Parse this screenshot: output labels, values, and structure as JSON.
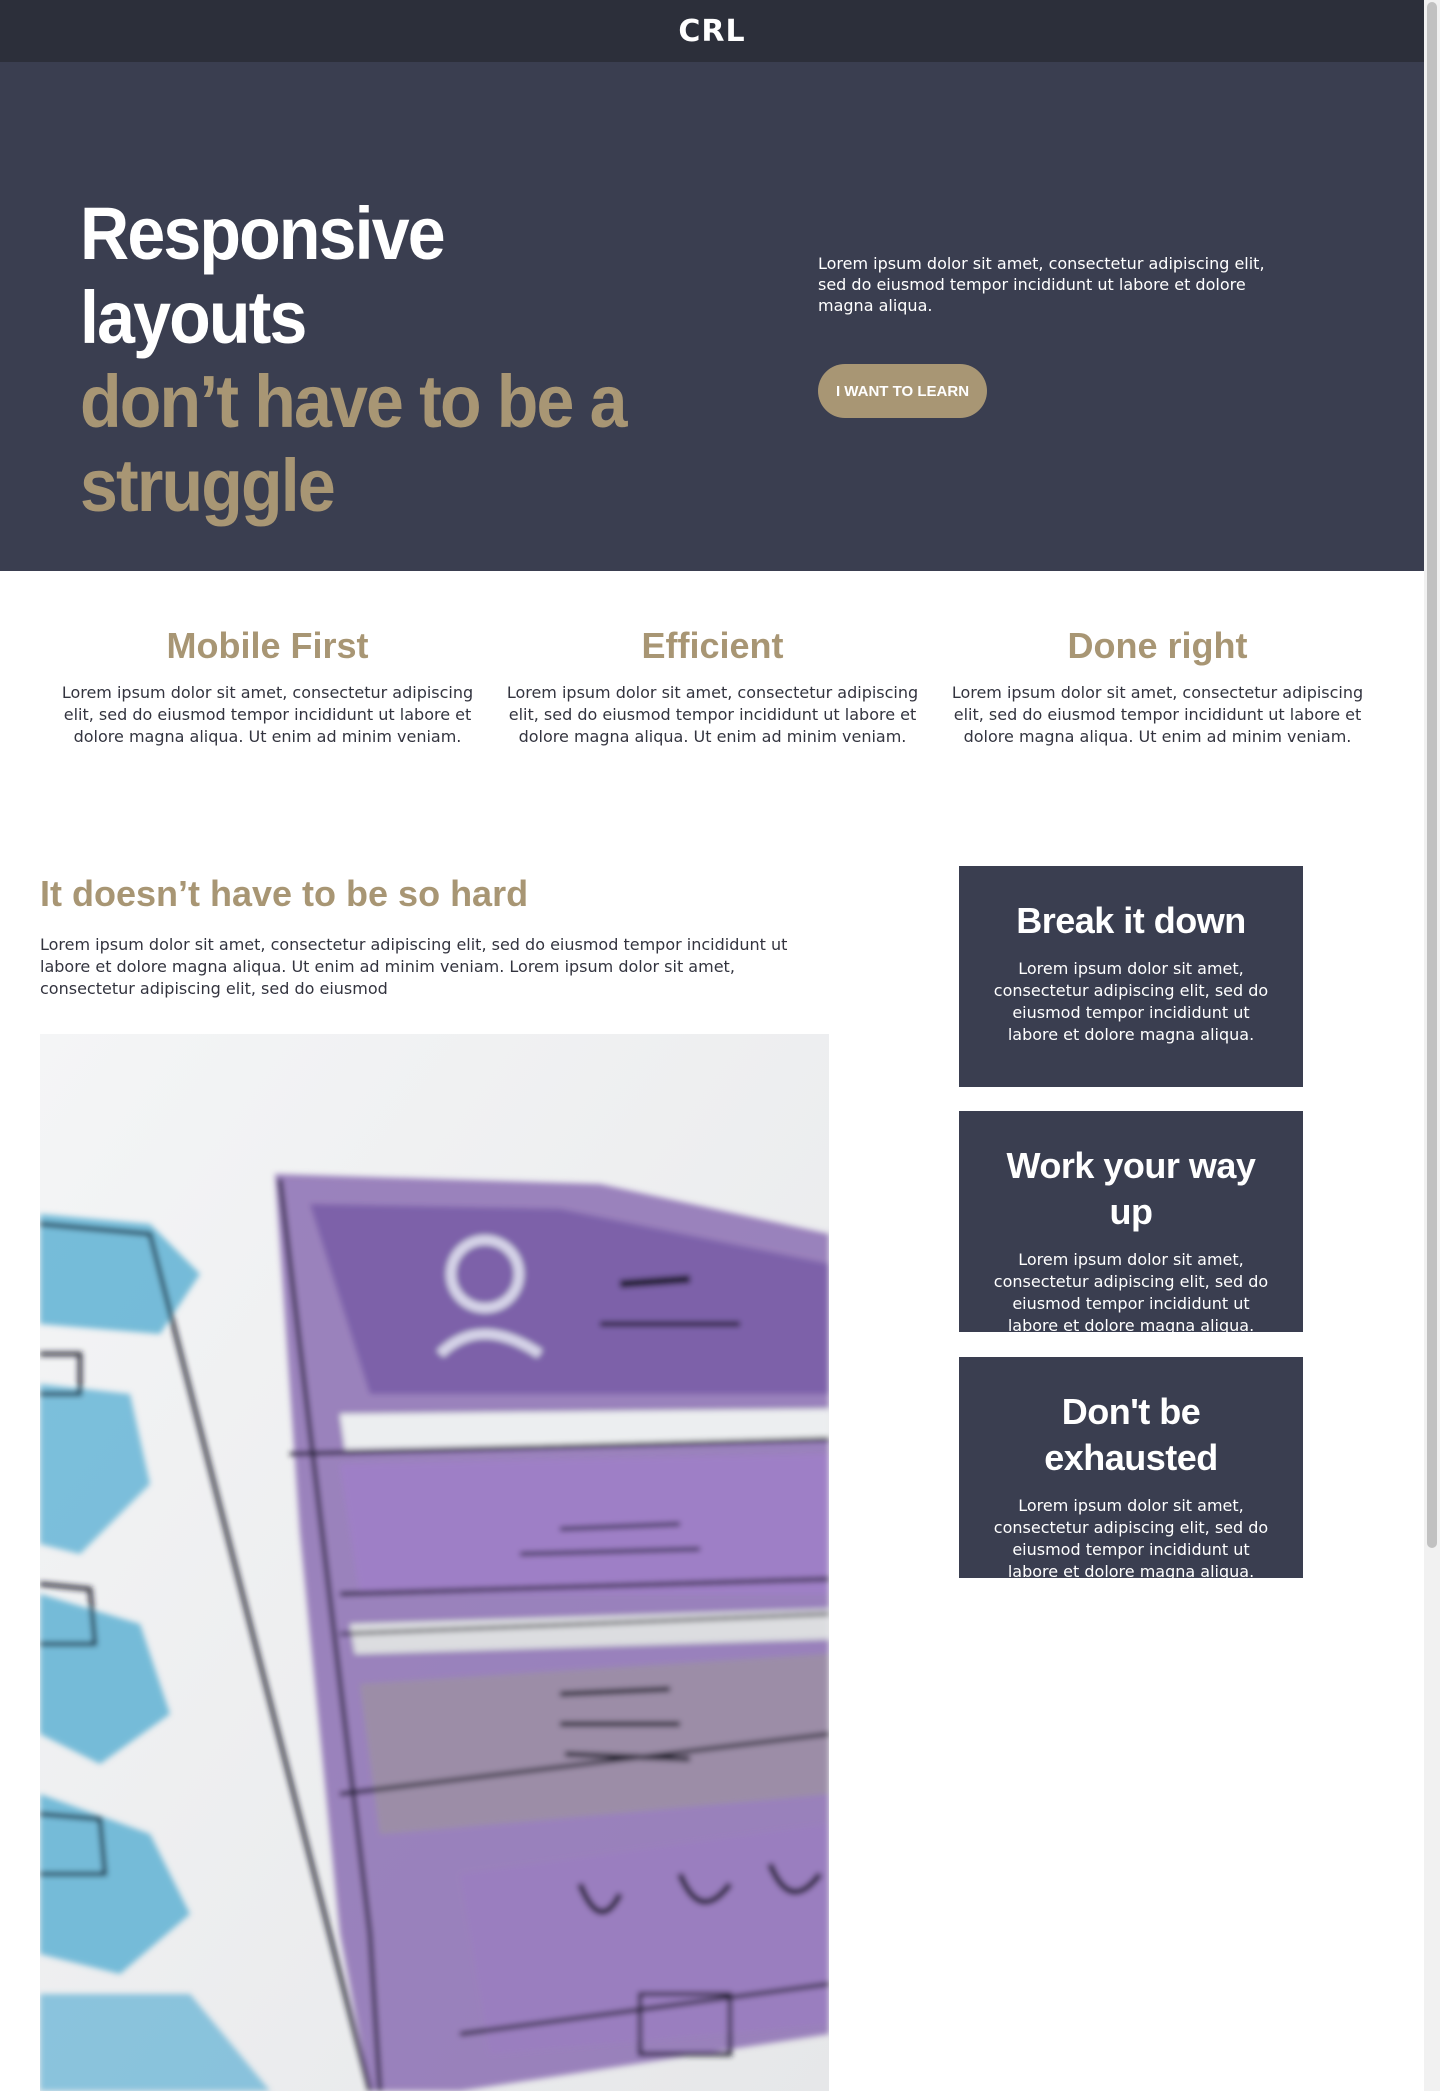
{
  "header": {
    "logo": "CRL"
  },
  "hero": {
    "title_line1": "Responsive layouts",
    "title_line2": "don’t have to be a struggle",
    "text": "Lorem ipsum dolor sit amet, consectetur adipiscing elit, sed do eiusmod tempor incididunt ut labore et dolore magna aliqua.",
    "button_label": "I want to learn"
  },
  "features": [
    {
      "title": "Mobile First",
      "text": "Lorem ipsum dolor sit amet, consectetur adipiscing elit, sed do eiusmod tempor incididunt ut labore et dolore magna aliqua. Ut enim ad minim veniam."
    },
    {
      "title": "Efficient",
      "text": "Lorem ipsum dolor sit amet, consectetur adipiscing elit, sed do eiusmod tempor incididunt ut labore et dolore magna aliqua. Ut enim ad minim veniam."
    },
    {
      "title": "Done right",
      "text": "Lorem ipsum dolor sit amet, consectetur adipiscing elit, sed do eiusmod tempor incididunt ut labore et dolore magna aliqua. Ut enim ad minim veniam."
    }
  ],
  "main": {
    "title": "It doesn’t have to be so hard",
    "text": "Lorem ipsum dolor sit amet, consectetur adipiscing elit, sed do eiusmod tempor incididunt ut labore et dolore magna aliqua. Ut enim ad minim veniam. Lorem ipsum dolor sit amet, consectetur adipiscing elit, sed do eiusmod"
  },
  "sidebar": {
    "cards": [
      {
        "title": "Break it down",
        "text": "Lorem ipsum dolor sit amet, consectetur adipiscing elit, sed do eiusmod tempor incididunt ut labore et dolore magna aliqua."
      },
      {
        "title": "Work your way up",
        "text": "Lorem ipsum dolor sit amet, consectetur adipiscing elit, sed do eiusmod tempor incididunt ut labore et dolore magna aliqua."
      },
      {
        "title": "Don't be exhausted",
        "text": "Lorem ipsum dolor sit amet, consectetur adipiscing elit, sed do eiusmod tempor incididunt ut labore et dolore magna aliqua."
      }
    ]
  },
  "colors": {
    "nav_bg": "#2c2f3a",
    "hero_bg": "#3a3e50",
    "accent": "#a89674",
    "text": "#33343f",
    "sketch_purple": "#7b5ea7",
    "sketch_blue": "#5fb1d4"
  }
}
